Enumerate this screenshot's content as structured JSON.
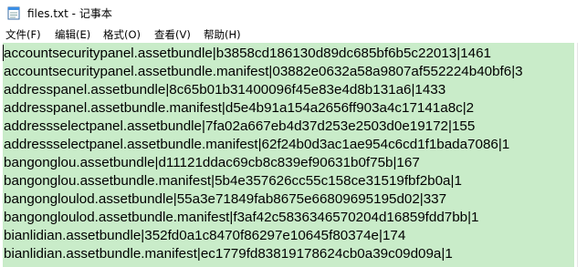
{
  "window": {
    "title": "files.txt - 记事本"
  },
  "menu": {
    "items": [
      "文件(F)",
      "编辑(E)",
      "格式(O)",
      "查看(V)",
      "帮助(H)"
    ]
  },
  "editor": {
    "selection_color": "#c9ecc9",
    "lines": [
      "accountsecuritypanel.assetbundle|b3858cd186130d89dc685bf6b5c22013|1461",
      "accountsecuritypanel.assetbundle.manifest|03882e0632a58a9807af552224b40bf6|3",
      "addresspanel.assetbundle|8c65b01b31400096f45e83e4d8b131a6|1433",
      "addresspanel.assetbundle.manifest|d5e4b91a154a2656ff903a4c17141a8c|2",
      "addressselectpanel.assetbundle|7fa02a667eb4d37d253e2503d0e19172|155",
      "addressselectpanel.assetbundle.manifest|62f24b0d3ac1ae954c6cd1f1bada7086|1",
      "bangonglou.assetbundle|d11121ddac69cb8c839ef90631b0f75b|167",
      "bangonglou.assetbundle.manifest|5b4e357626cc55c158ce31519fbf2b0a|1",
      "bangongloulod.assetbundle|55a3e71849fab8675e66809695195d02|337",
      "bangongloulod.assetbundle.manifest|f3af42c5836346570204d16859fdd7bb|1",
      "bianlidian.assetbundle|352fd0a1c8470f86297e10645f80374e|174",
      "bianlidian.assetbundle.manifest|ec1779fd83819178624cb0a39c09d09a|1"
    ]
  }
}
